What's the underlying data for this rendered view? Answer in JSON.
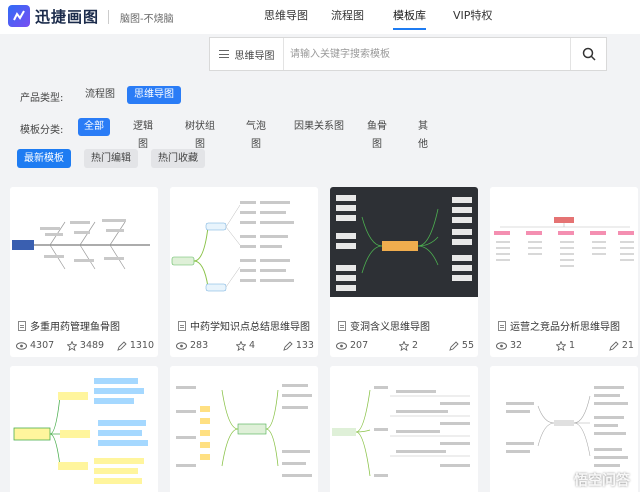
{
  "brand": {
    "name": "迅捷画图",
    "slogan": "脑图-不烧脑"
  },
  "nav": [
    {
      "label": "思维导图"
    },
    {
      "label": "流程图"
    },
    {
      "label": "模板库"
    },
    {
      "label": "VIP特权"
    }
  ],
  "search": {
    "category": "思维导图",
    "placeholder": "请输入关键字搜索模板"
  },
  "product_filter": {
    "label": "产品类型:",
    "options": [
      "流程图",
      "思维导图"
    ],
    "selected": "思维导图"
  },
  "category_filter": {
    "label": "模板分类:",
    "options": [
      "全部",
      "逻辑图",
      "树状组图",
      "气泡图",
      "因果关系图",
      "鱼骨图",
      "其他"
    ],
    "selected": "全部"
  },
  "sort_tabs": [
    "最新模板",
    "热门编辑",
    "热门收藏"
  ],
  "cards": [
    {
      "title": "多重用药管理鱼骨图",
      "views": "4307",
      "favorites": "3489",
      "edits": "1310"
    },
    {
      "title": "中药学知识点总结思维导图",
      "views": "283",
      "favorites": "4",
      "edits": "133"
    },
    {
      "title": "变洞含义思维导图",
      "views": "207",
      "favorites": "2",
      "edits": "55"
    },
    {
      "title": "运营之竞品分析思维导图",
      "views": "32",
      "favorites": "1",
      "edits": "21"
    }
  ],
  "watermark": "悟空问答",
  "colors": {
    "accent": "#1e7cf2",
    "dark_thumb": "#2d3035"
  }
}
